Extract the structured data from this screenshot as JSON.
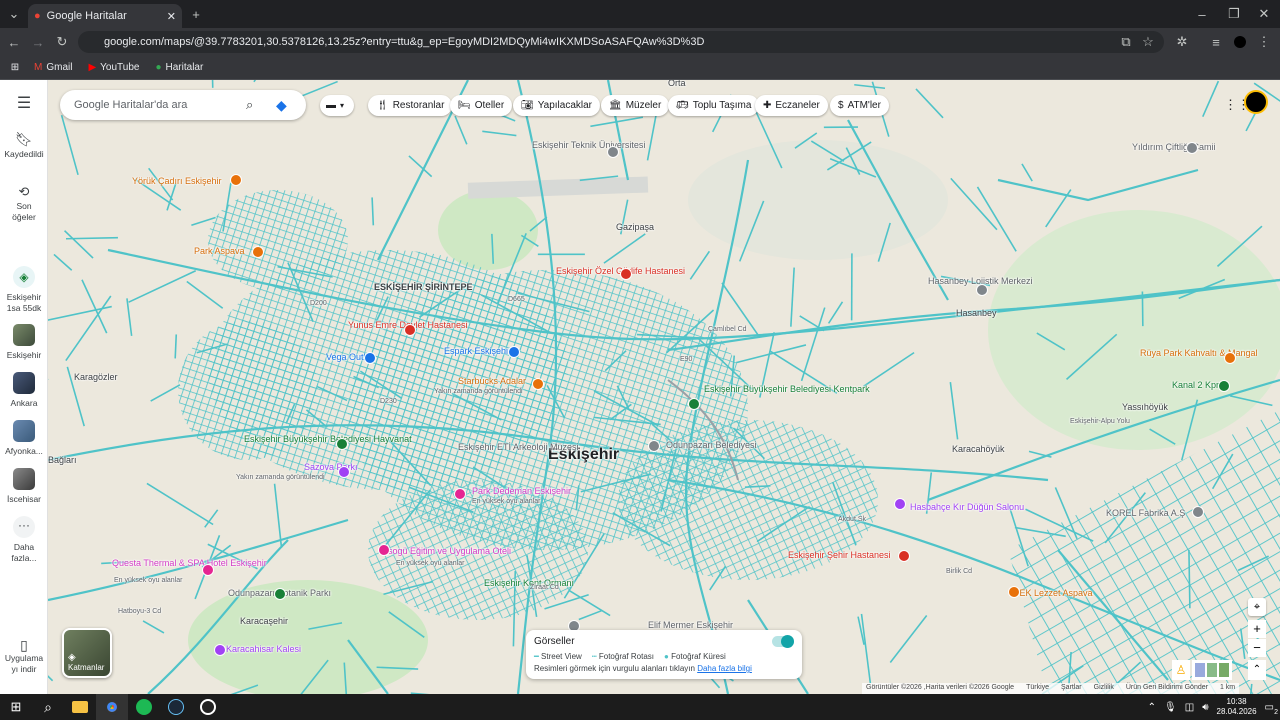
{
  "browser": {
    "tab_title": "Google Haritalar",
    "url": "google.com/maps/@39.7783201,30.5378126,13.25z?entry=ttu&g_ep=EgoyMDI2MDQyMi4wIKXMDSoASAFQAw%3D%3D",
    "bookmarks": [
      {
        "label": "Gmail"
      },
      {
        "label": "YouTube"
      },
      {
        "label": "Haritalar"
      }
    ]
  },
  "rail": {
    "saved": "Kaydedildi",
    "recent": "Son öğeler",
    "recent_places": [
      {
        "label": "Eskişehir 1sa 55dk"
      },
      {
        "label": "Eskişehir"
      },
      {
        "label": "Ankara"
      },
      {
        "label": "Afyonka..."
      },
      {
        "label": "İscehisar"
      }
    ],
    "more": "Daha fazla...",
    "get_app": "Uygulama yı indir"
  },
  "search": {
    "placeholder": "Google Haritalar'da ara"
  },
  "chips": [
    "Restoranlar",
    "Oteller",
    "Yapılacaklar",
    "Müzeler",
    "Toplu Taşıma",
    "Eczaneler",
    "ATM'ler"
  ],
  "map_labels": {
    "city": "Eskişehir",
    "towns": [
      "Orta",
      "Gazipaşa",
      "Hasanbey",
      "Karagözler",
      "Karacahöyük",
      "Yassıhöyük",
      "Karacaşehir",
      "Bağları",
      "ESKİŞEHİR ŞİRİNTEPE"
    ],
    "places": [
      "Yörük Çadırı Eskişehir",
      "Park Aspava",
      "Eskişehir Teknik Üniversitesi",
      "Yıldırım Çiftliği Camii",
      "Eskişehir Özel Gürlife Hastanesi",
      "Hasanbey Lojistik Merkezi",
      "Yunus Emre Devlet Hastanesi",
      "Vega Outlet",
      "Espark Eskişehir",
      "Starbucks Adalar",
      "Rüya Park Kahvaltı & Mangal",
      "Kanal 2 Kpr",
      "Eskişehir Büyükşehir Belediyesi Kentpark",
      "Eskişehir Büyükşehir Belediyesi Hayvanat",
      "Sazova Parkı",
      "Eskişehir ETİ Arkeoloji Müzesi",
      "Odunpazarı Belediyesi",
      "Hasbahçe Kır Düğün Salonu",
      "KOREL Fabrika A.Ş",
      "Park Dedeman Eskişehir",
      "Esogü Eğitim ve Uygulama Oteli",
      "Eskişehir Şehir Hastanesi",
      "Questa Thermal & SPA Hotel Eskişehir",
      "Odunpazarı Botanik Parkı",
      "TEK Lezzet Aspava",
      "Eskişehir Kent Ormanı",
      "Elif Mermer Eskişehir",
      "Karacahisar Kalesi"
    ],
    "notes": {
      "recent": "Yakın zamanda görüntülendi",
      "popular": "En yüksek oyu alanlar"
    },
    "roads": [
      "D200",
      "D230",
      "D665",
      "E90",
      "Hatboyu-3 Cd",
      "Ziraat Cd",
      "Akdut Sk",
      "Birlik Cd",
      "Çamlıbel Cd",
      "Eskişehir-Alpu Yolu"
    ]
  },
  "layer_card": {
    "title": "Görseller",
    "items": [
      "Street View",
      "Fotoğraf Rotası",
      "Fotoğraf Küresi"
    ],
    "hint": "Resimleri görmek için vurgulu alanları tıklayın",
    "link": "Daha fazla bilgi"
  },
  "layers_btn": "Katmanlar",
  "footer": [
    "Görüntüler ©2026 ,Harita verileri ©2026 Google",
    "Türkiye",
    "Şartlar",
    "Gizlilik",
    "Ürün Geri Bildirimi Gönder",
    "1 km"
  ],
  "taskbar": {
    "time": "10:38",
    "date": "28.04.2026",
    "notif": "2"
  },
  "colors": {
    "streetview": "#4fc3c8",
    "map_bg": "#ece8dd",
    "park": "#cfe8c4"
  }
}
